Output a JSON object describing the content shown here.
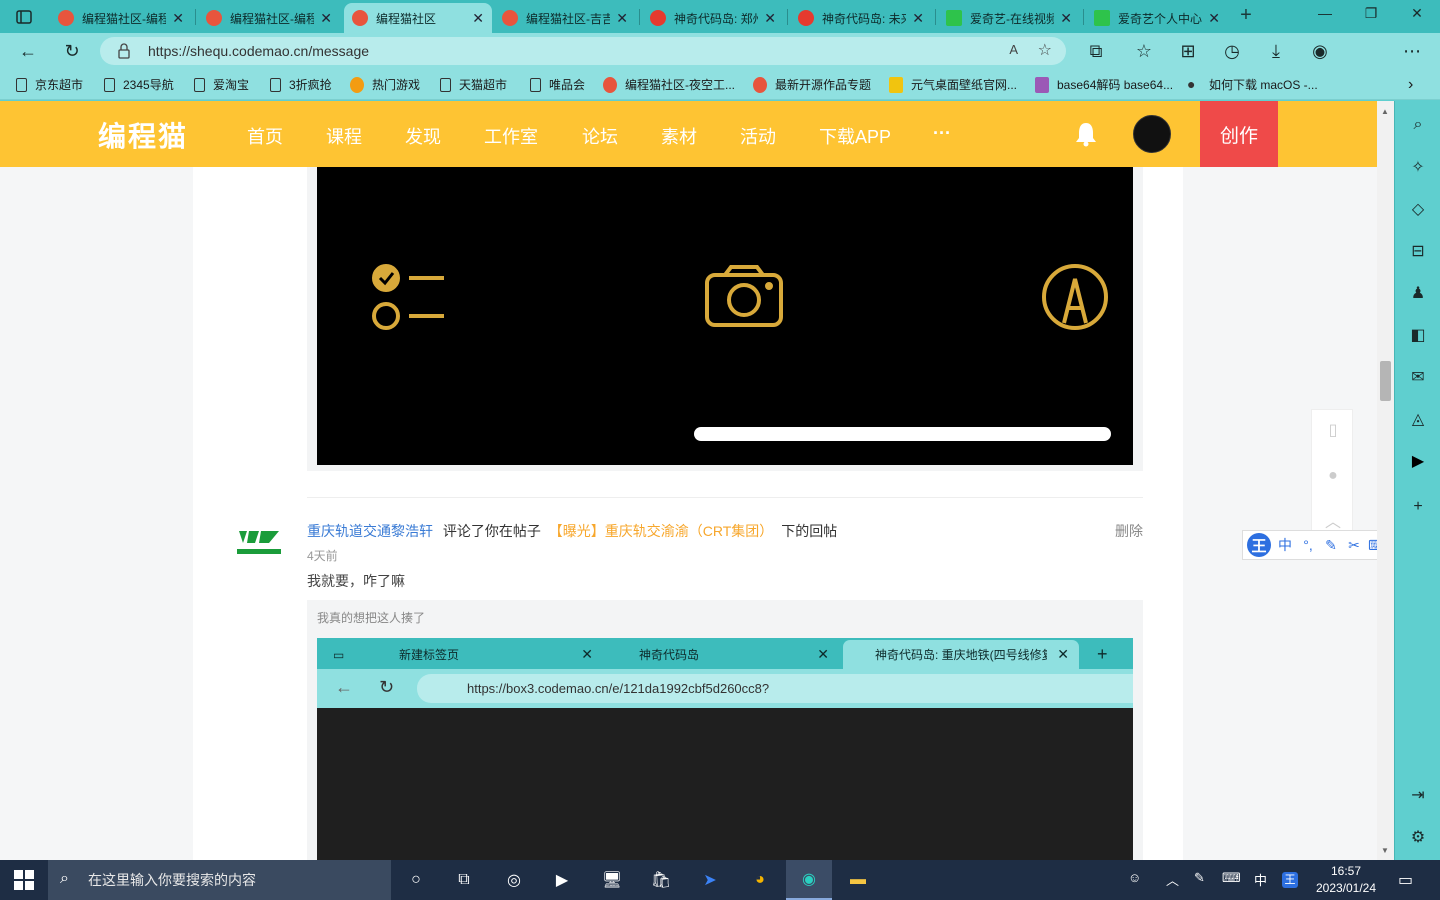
{
  "browser": {
    "tabs": [
      {
        "title": "编程猫社区-编程",
        "active": false
      },
      {
        "title": "编程猫社区-编程",
        "active": false
      },
      {
        "title": "编程猫社区",
        "active": true
      },
      {
        "title": "编程猫社区-吉吉",
        "active": false
      },
      {
        "title": "神奇代码岛: 郑州",
        "active": false
      },
      {
        "title": "神奇代码岛: 未来",
        "active": false
      },
      {
        "title": "爱奇艺-在线视频",
        "active": false
      },
      {
        "title": "爱奇艺个人中心",
        "active": false
      }
    ],
    "url": "https://shequ.codemao.cn/message",
    "read_aloud": "A",
    "bookmarks": [
      "京东超市",
      "2345导航",
      "爱淘宝",
      "3折疯抢",
      "热门游戏",
      "天猫超市",
      "唯品会",
      "编程猫社区-夜空工...",
      "最新开源作品专题",
      "元气桌面壁纸官网...",
      "base64解码 base64...",
      "如何下载 macOS -..."
    ]
  },
  "site": {
    "logo": "编程猫",
    "nav": [
      "首页",
      "课程",
      "发现",
      "工作室",
      "论坛",
      "素材",
      "活动",
      "下载APP",
      "···"
    ],
    "create_label": "创作"
  },
  "comment": {
    "user": "重庆轨道交通黎浩轩",
    "action": "评论了你在帖子",
    "post": "【曝光】重庆轨交渝渝（CRT集团）",
    "suffix": "下的回帖",
    "delete": "删除",
    "time": "4天前",
    "text": "我就要，咋了嘛",
    "quote": "我真的想把这人揍了",
    "embedded": {
      "tabs": [
        "新建标签页",
        "神奇代码岛",
        "神奇代码岛: 重庆地铁(四号线修复"
      ],
      "url": "https://box3.codemao.cn/e/121da1992cbf5d260cc8?"
    }
  },
  "ime": {
    "logo": "王",
    "mode": "中"
  },
  "taskbar": {
    "search_placeholder": "在这里输入你要搜索的内容",
    "ime_lang": "中",
    "time": "16:57",
    "date": "2023/01/24"
  }
}
